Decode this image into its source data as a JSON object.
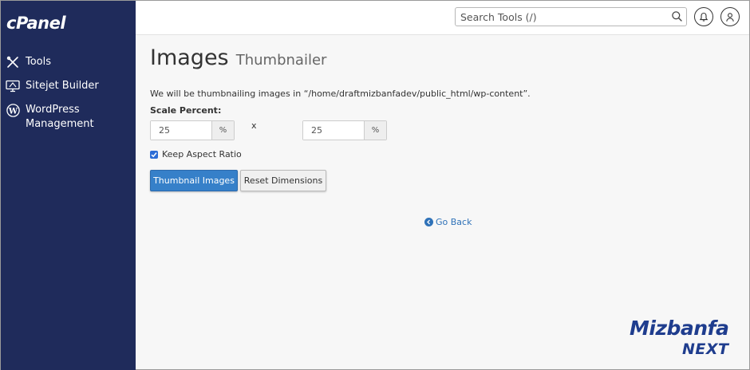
{
  "sidebar": {
    "logo": "cPanel",
    "items": [
      {
        "label": "Tools",
        "icon": "tools-icon"
      },
      {
        "label": "Sitejet Builder",
        "icon": "sitejet-icon"
      },
      {
        "label": "WordPress Management",
        "icon": "wordpress-icon"
      }
    ]
  },
  "header": {
    "search_placeholder": "Search Tools (/)"
  },
  "page": {
    "title": "Images",
    "subtitle": "Thumbnailer",
    "description": "We will be thumbnailing images in “/home/draftmizbanfadev/public_html/wp-content”.",
    "scale_label": "Scale Percent:",
    "scale_x": "25",
    "scale_y": "25",
    "percent_addon": "%",
    "times_symbol": "x",
    "keep_aspect_label": "Keep Aspect Ratio",
    "keep_aspect_checked": true,
    "thumbnail_button": "Thumbnail Images",
    "reset_button": "Reset Dimensions",
    "go_back": "Go Back"
  },
  "watermark": {
    "line1": "Mizbanfa",
    "line2": "NEXT"
  },
  "colors": {
    "sidebar_bg": "#1f2b5b",
    "primary": "#3680c9",
    "link": "#2f72b8",
    "watermark": "#1f3d8e"
  }
}
